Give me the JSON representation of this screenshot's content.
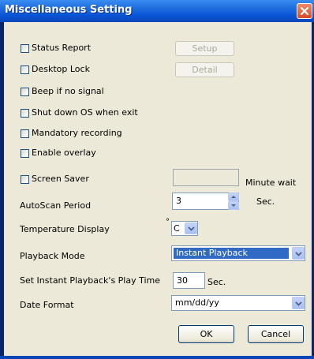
{
  "window": {
    "title": "Miscellaneous Setting"
  },
  "options": {
    "status_report": "Status Report",
    "desktop_lock": "Desktop Lock",
    "beep_no_signal": "Beep if no signal",
    "shutdown_os": "Shut down OS when exit",
    "mandatory_recording": "Mandatory recording",
    "enable_overlay": "Enable overlay",
    "screen_saver": "Screen Saver"
  },
  "buttons": {
    "setup": "Setup",
    "detail": "Detail",
    "ok": "OK",
    "cancel": "Cancel"
  },
  "screen_saver": {
    "value": "",
    "suffix": "Minute wait"
  },
  "autoscan": {
    "label": "AutoScan Period",
    "value": "3",
    "unit": "Sec."
  },
  "temperature": {
    "label": "Temperature Display",
    "degree_symbol": "°",
    "value": "C"
  },
  "playback": {
    "label": "Playback Mode",
    "value": "Instant Playback"
  },
  "instant_time": {
    "label": "Set Instant Playback's Play Time",
    "value": "30",
    "unit": "Sec."
  },
  "date_format": {
    "label": "Date Format",
    "value": "mm/dd/yy"
  },
  "colors": {
    "title_bar": "#0a54d6",
    "selection": "#316ac5",
    "close_button": "#d94b24"
  }
}
